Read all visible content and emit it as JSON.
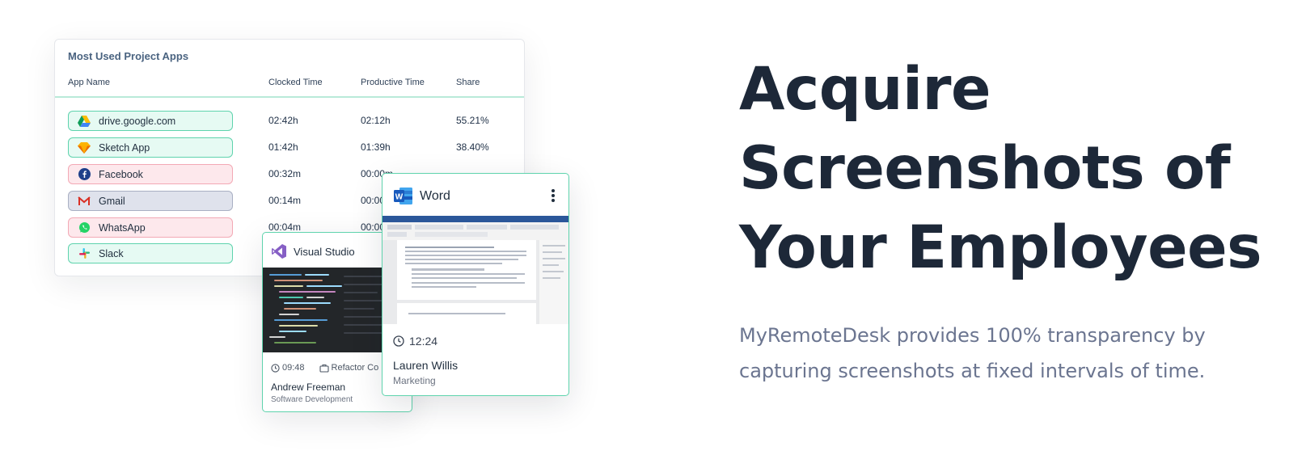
{
  "apps_table": {
    "title": "Most Used Project Apps",
    "columns": [
      "App Name",
      "Clocked Time",
      "Productive Time",
      "Share"
    ],
    "rows": [
      {
        "app": "drive.google.com",
        "icon": "google-drive-icon",
        "clocked": "02:42h",
        "productive": "02:12h",
        "share": "55.21%",
        "style": "green"
      },
      {
        "app": "Sketch App",
        "icon": "sketch-icon",
        "clocked": "01:42h",
        "productive": "01:39h",
        "share": "38.40%",
        "style": "green"
      },
      {
        "app": "Facebook",
        "icon": "facebook-icon",
        "clocked": "00:32m",
        "productive": "00:00m",
        "share": "",
        "style": "red"
      },
      {
        "app": "Gmail",
        "icon": "gmail-icon",
        "clocked": "00:14m",
        "productive": "00:00",
        "share": "",
        "style": "gray"
      },
      {
        "app": "WhatsApp",
        "icon": "whatsapp-icon",
        "clocked": "00:04m",
        "productive": "00:00",
        "share": "",
        "style": "red"
      },
      {
        "app": "Slack",
        "icon": "slack-icon",
        "clocked": "",
        "productive": "",
        "share": "",
        "style": "green"
      }
    ]
  },
  "vs_card": {
    "app": "Visual Studio",
    "time": "09:48",
    "task": "Refactor Co",
    "user": "Andrew Freeman",
    "department": "Software Development"
  },
  "word_card": {
    "app": "Word",
    "time": "12:24",
    "user": "Lauren Willis",
    "department": "Marketing"
  },
  "hero": {
    "title_lines": [
      "Acquire",
      "Screenshots of",
      "Your Employees"
    ],
    "subtitle_lines": [
      "MyRemoteDesk provides 100% transparency by",
      "capturing screenshots at fixed intervals of time."
    ]
  },
  "colors": {
    "accent_green": "#5fd3ad",
    "heading": "#1d2838",
    "subtext": "#6b7590"
  }
}
